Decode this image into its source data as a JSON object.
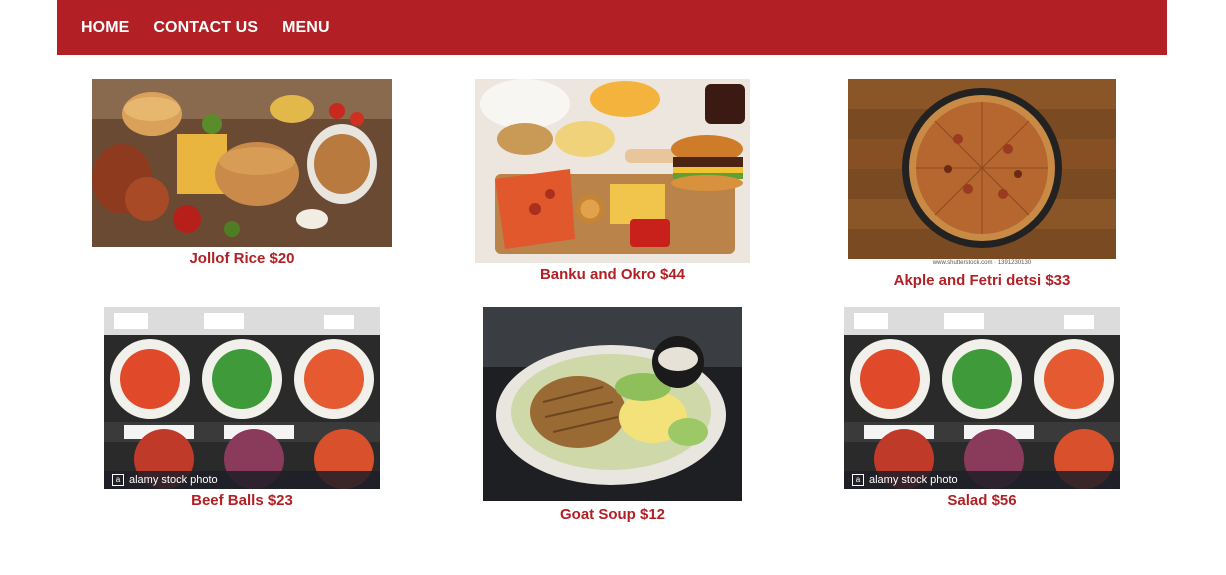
{
  "nav": {
    "items": [
      {
        "label": "HOME"
      },
      {
        "label": "CONTACT US"
      },
      {
        "label": "MENU"
      }
    ]
  },
  "menu_items": [
    {
      "caption": "Jollof Rice $20",
      "image": "fast-food-platter-photo"
    },
    {
      "caption": "Banku and Okro $44",
      "image": "snacks-board-photo"
    },
    {
      "caption": "Akple and Fetri detsi $33",
      "image": "pizza-photo",
      "watermark": "www.shutterstock.com · 1391230130"
    },
    {
      "caption": "Beef Balls $23",
      "image": "food-display-photo",
      "watermark": "alamy stock photo"
    },
    {
      "caption": "Goat Soup $12",
      "image": "chicken-salad-photo"
    },
    {
      "caption": "Salad $56",
      "image": "food-display-photo",
      "watermark": "alamy stock photo"
    }
  ],
  "colors": {
    "brand": "#b21f24",
    "nav_text": "#ffffff",
    "caption": "#b21f24"
  }
}
